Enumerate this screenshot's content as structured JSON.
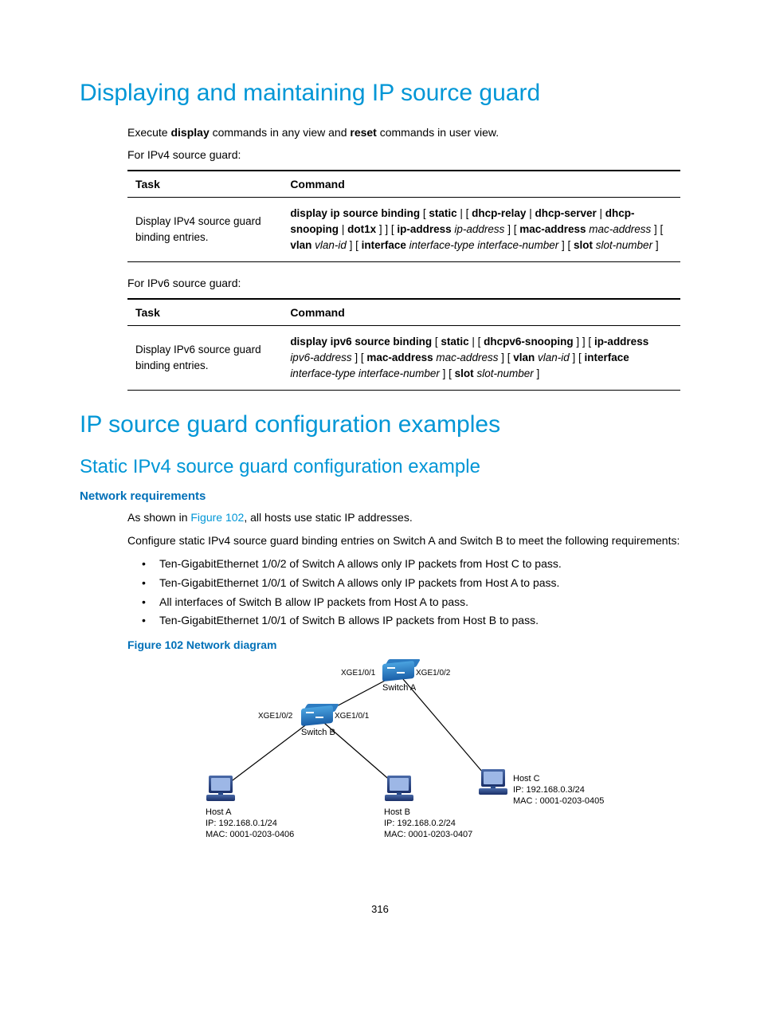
{
  "h1_a": "Displaying and maintaining IP source guard",
  "intro_pre": "Execute ",
  "intro_b1": "display",
  "intro_mid": " commands in any view and ",
  "intro_b2": "reset",
  "intro_post": " commands in user view.",
  "for_ipv4": "For IPv4 source guard:",
  "for_ipv6": "For IPv6 source guard:",
  "th_task": "Task",
  "th_cmd": "Command",
  "ipv4_task": "Display IPv4 source guard binding entries.",
  "ipv6_task": "Display IPv6 source guard binding entries.",
  "ipv4_cmd": {
    "p1": "display ip source binding",
    "p2": " [ ",
    "p3": "static",
    "p4": " | [ ",
    "p5": "dhcp-relay",
    "p6": " | ",
    "p7": "dhcp-server",
    "p8": " | ",
    "p9": "dhcp-snooping",
    "p10": " | ",
    "p11": "dot1x",
    "p12": " ] ] [ ",
    "p13": "ip-address",
    "p14": " ip-address",
    "p15": " ] [ ",
    "p16": "mac-address",
    "p17": " mac-address",
    "p18": " ] [ ",
    "p19": "vlan",
    "p20": " vlan-id",
    "p21": " ] [ ",
    "p22": "interface",
    "p23": " interface-type interface-number",
    "p24": " ] [ ",
    "p25": "slot",
    "p26": " slot-number",
    "p27": " ]"
  },
  "ipv6_cmd": {
    "p1": "display ipv6 source binding",
    "p2": " [ ",
    "p3": "static",
    "p4": " | [ ",
    "p5": "dhcpv6-snooping",
    "p6": " ] ] [ ",
    "p7": "ip-address",
    "p8": " ipv6-address",
    "p9": " ] [ ",
    "p10": "mac-address",
    "p11": " mac-address",
    "p12": " ] [ ",
    "p13": "vlan",
    "p14": " vlan-id",
    "p15": " ] [ ",
    "p16": "interface",
    "p17": " interface-type interface-number",
    "p18": " ] [ ",
    "p19": "slot",
    "p20": " slot-number",
    "p21": " ]"
  },
  "h1_b": "IP source guard configuration examples",
  "h2_a": "Static IPv4 source guard configuration example",
  "h3_a": "Network requirements",
  "req_intro_pre": "As shown in ",
  "req_intro_link": "Figure 102",
  "req_intro_post": ", all hosts use static IP addresses.",
  "req_para2": "Configure static IPv4 source guard binding entries on Switch A and Switch B to meet the following requirements:",
  "bullets": [
    "Ten-GigabitEthernet 1/0/2 of Switch A allows only IP packets from Host C to pass.",
    "Ten-GigabitEthernet 1/0/1 of Switch A allows only IP packets from Host A to pass.",
    "All interfaces of Switch B allow IP packets from Host A to pass.",
    "Ten-GigabitEthernet 1/0/1 of Switch B allows IP packets from Host B to pass."
  ],
  "fig_caption": "Figure 102 Network diagram",
  "diagram": {
    "switch_a": "Switch A",
    "switch_b": "Switch B",
    "host_a_name": "Host A",
    "host_a_ip": "IP: 192.168.0.1/24",
    "host_a_mac": "MAC: 0001-0203-0406",
    "host_b_name": "Host B",
    "host_b_ip": "IP: 192.168.0.2/24",
    "host_b_mac": "MAC: 0001-0203-0407",
    "host_c_name": "Host C",
    "host_c_ip": "IP: 192.168.0.3/24",
    "host_c_mac": "MAC : 0001-0203-0405",
    "xge101": "XGE1/0/1",
    "xge102": "XGE1/0/2"
  },
  "pagenum": "316"
}
